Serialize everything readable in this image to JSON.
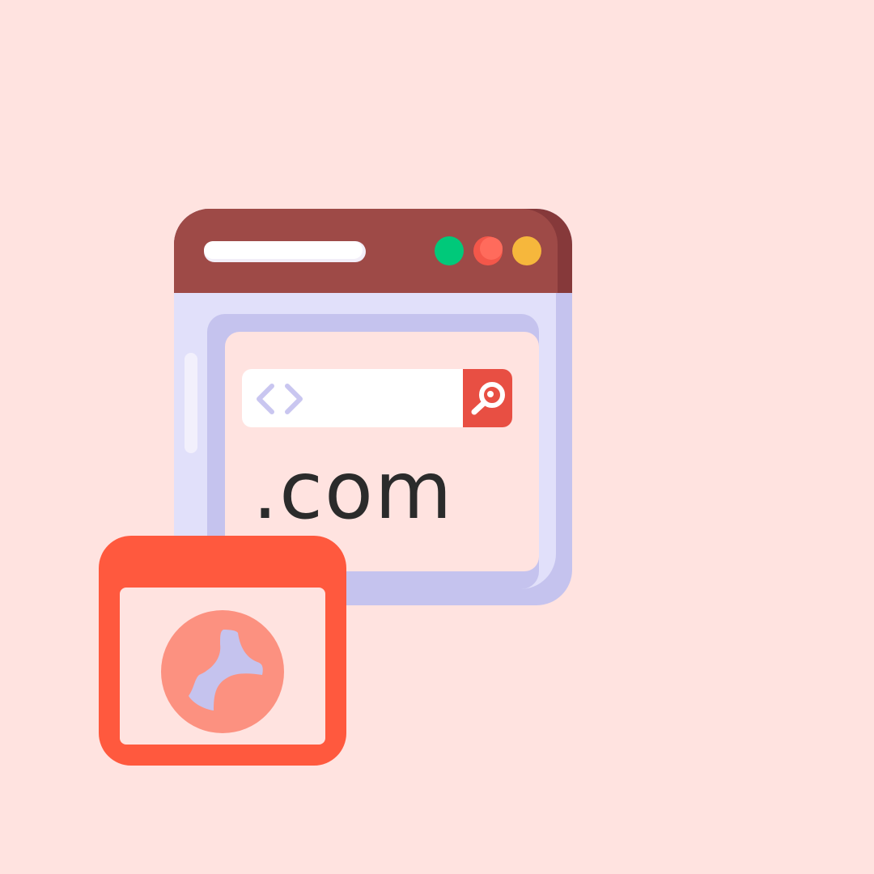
{
  "browser": {
    "address_bar_icon": "code-brackets-icon",
    "search_icon": "search-icon",
    "domain_text": ".com",
    "window_controls": [
      {
        "name": "green-dot",
        "color": "#00C97A"
      },
      {
        "name": "red-dot",
        "color": "#F4574A"
      },
      {
        "name": "yellow-dot",
        "color": "#F6B73C"
      }
    ]
  },
  "palette": {
    "background": "#FFE3E0",
    "titlebar": "#9E4A47",
    "frame": "#E1E0FA",
    "frame_shadow": "#C5C3EE",
    "content": "#FFE3E0",
    "accent": "#F4574A",
    "front_window": "#FF593E",
    "globe": "#FC9180"
  },
  "front_window": {
    "icon": "globe-icon"
  }
}
